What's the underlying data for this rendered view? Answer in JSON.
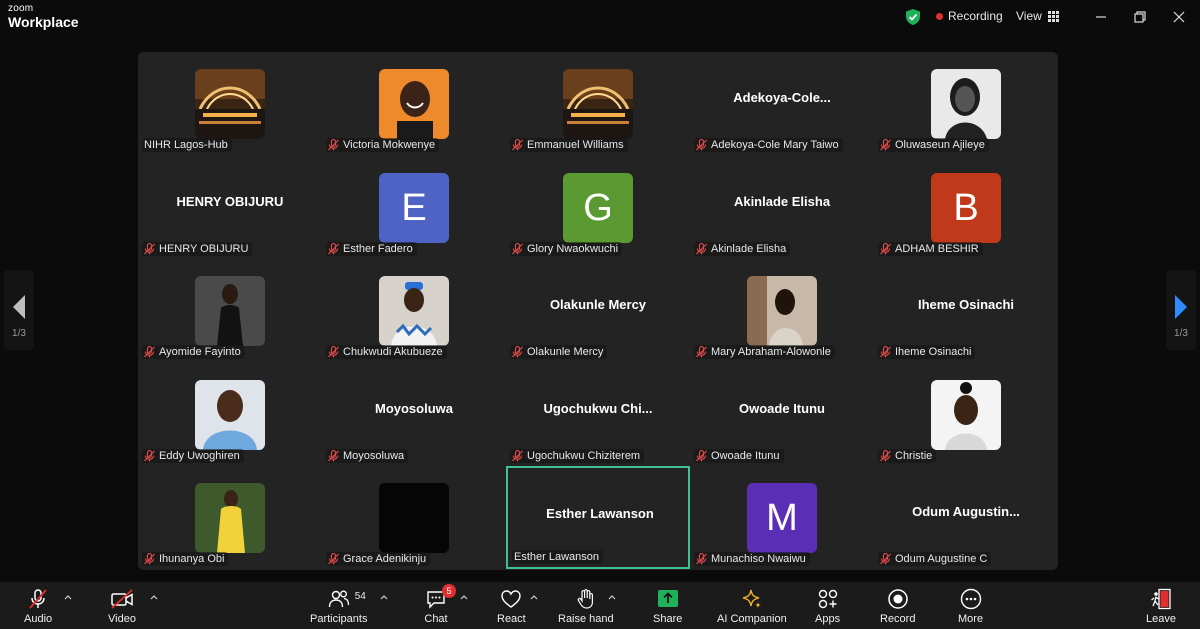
{
  "app": {
    "brand_top": "zoom",
    "brand_bottom": "Workplace"
  },
  "titlebar": {
    "recording": "Recording",
    "view": "View"
  },
  "colors": {
    "active_border": "#3ec28f",
    "recording_dot": "#e02f2f",
    "shield": "#1fb05a",
    "share": "#1fb05a"
  },
  "pagination": {
    "left": "1/3",
    "right": "1/3"
  },
  "participants": [
    {
      "name": "NIHR Lagos-Hub",
      "display": "",
      "type": "photo",
      "photo": "lagos",
      "muted": false,
      "active": false
    },
    {
      "name": "Victoria Mokwenye",
      "display": "",
      "type": "photo",
      "photo": "victoria",
      "muted": true,
      "active": false
    },
    {
      "name": "Emmanuel Williams",
      "display": "",
      "type": "photo",
      "photo": "lagos",
      "muted": true,
      "active": false
    },
    {
      "name": "Adekoya-Cole Mary Taiwo",
      "display": "Adekoya-Cole...",
      "type": "text",
      "muted": true,
      "active": false
    },
    {
      "name": "Oluwaseun Ajileye",
      "display": "",
      "type": "photo",
      "photo": "oluwaseun",
      "muted": true,
      "active": false
    },
    {
      "name": "HENRY OBIJURU",
      "display": "HENRY OBIJURU",
      "type": "text",
      "muted": true,
      "active": false
    },
    {
      "name": "Esther Fadero",
      "display": "",
      "type": "letter",
      "letter": "E",
      "color": "#4f63c4",
      "muted": true,
      "active": false
    },
    {
      "name": "Glory Nwaokwuchi",
      "display": "",
      "type": "letter",
      "letter": "G",
      "color": "#5b9a32",
      "muted": true,
      "active": false
    },
    {
      "name": "Akinlade Elisha",
      "display": "Akinlade Elisha",
      "type": "text",
      "muted": true,
      "active": false
    },
    {
      "name": "ADHAM BESHIR",
      "display": "",
      "type": "letter",
      "letter": "B",
      "color": "#c0391b",
      "muted": true,
      "active": false
    },
    {
      "name": "Ayomide Fayinto",
      "display": "",
      "type": "photo",
      "photo": "ayomide",
      "muted": true,
      "active": false
    },
    {
      "name": "Chukwudi Akubueze",
      "display": "",
      "type": "photo",
      "photo": "chukwudi",
      "muted": true,
      "active": false
    },
    {
      "name": "Olakunle Mercy",
      "display": "Olakunle Mercy",
      "type": "text",
      "muted": true,
      "active": false
    },
    {
      "name": "Mary Abraham-Alowonle",
      "display": "",
      "type": "photo",
      "photo": "mary",
      "muted": true,
      "active": false
    },
    {
      "name": "Iheme Osinachi",
      "display": "Iheme Osinachi",
      "type": "text",
      "muted": true,
      "active": false
    },
    {
      "name": "Eddy Uwoghiren",
      "display": "",
      "type": "photo",
      "photo": "eddy",
      "muted": true,
      "active": false
    },
    {
      "name": "Moyosoluwa",
      "display": "Moyosoluwa",
      "type": "text",
      "muted": true,
      "active": false
    },
    {
      "name": "Ugochukwu Chiziterem",
      "display": "Ugochukwu  Chi...",
      "type": "text",
      "muted": true,
      "active": false
    },
    {
      "name": "Owoade Itunu",
      "display": "Owoade Itunu",
      "type": "text",
      "muted": true,
      "active": false
    },
    {
      "name": "Christie",
      "display": "",
      "type": "photo",
      "photo": "christie",
      "muted": true,
      "active": false
    },
    {
      "name": "Ihunanya Obi",
      "display": "",
      "type": "photo",
      "photo": "ihunanya",
      "muted": true,
      "active": false
    },
    {
      "name": "Grace Adenikinju",
      "display": "",
      "type": "photo",
      "photo": "black",
      "muted": true,
      "active": false
    },
    {
      "name": "Esther Lawanson",
      "display": "Esther Lawanson",
      "type": "text",
      "muted": false,
      "active": true
    },
    {
      "name": "Munachiso Nwaiwu",
      "display": "",
      "type": "letter",
      "letter": "M",
      "color": "#5a2fb5",
      "muted": true,
      "active": false
    },
    {
      "name": "Odum Augustine C",
      "display": "Odum  Augustin...",
      "type": "text",
      "muted": true,
      "active": false
    }
  ],
  "toolbar": {
    "audio": "Audio",
    "video": "Video",
    "participants": "Participants",
    "participants_count": "54",
    "chat": "Chat",
    "chat_badge": "5",
    "react": "React",
    "raise_hand": "Raise hand",
    "share": "Share",
    "ai_companion": "AI Companion",
    "apps": "Apps",
    "record": "Record",
    "more": "More",
    "leave": "Leave"
  }
}
